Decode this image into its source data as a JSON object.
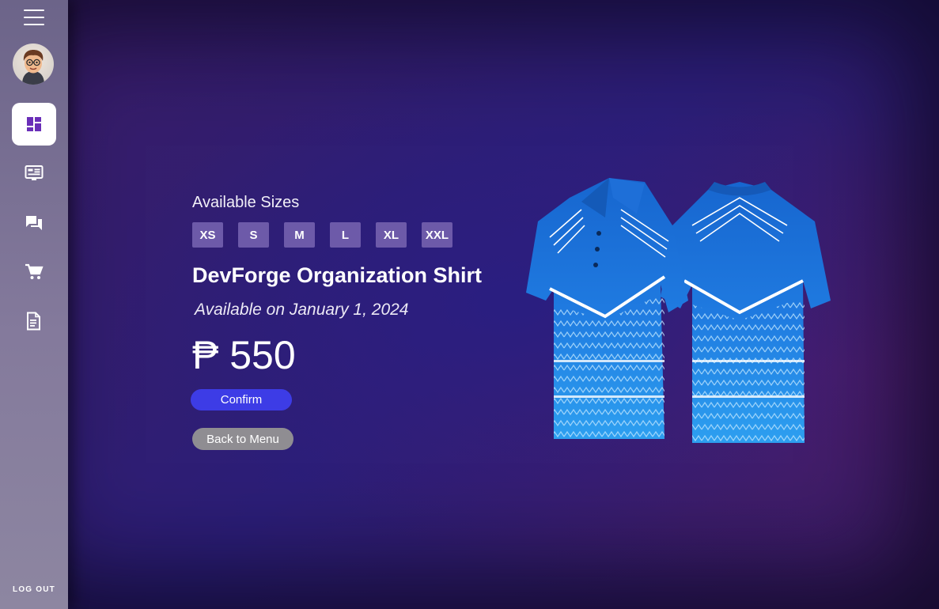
{
  "sidebar": {
    "menu_icon": "hamburger-menu-icon",
    "avatar": "user-avatar",
    "items": [
      {
        "icon": "dashboard-icon",
        "active": true
      },
      {
        "icon": "news-feed-icon",
        "active": false
      },
      {
        "icon": "chat-icon",
        "active": false
      },
      {
        "icon": "shopping-cart-icon",
        "active": false
      },
      {
        "icon": "document-icon",
        "active": false
      }
    ],
    "logout_label": "LOG OUT"
  },
  "product": {
    "sizes_title": "Available Sizes",
    "sizes": [
      "XS",
      "S",
      "M",
      "L",
      "XL",
      "XXL"
    ],
    "name": "DevForge Organization Shirt",
    "availability": "Available on January 1, 2024",
    "price": "₱ 550",
    "image": "blue-polo-shirt-front-and-back"
  },
  "actions": {
    "confirm_label": "Confirm",
    "back_label": "Back to Menu"
  },
  "colors": {
    "accent": "#3d3ce6",
    "active_icon": "#6a2fb8",
    "size_chip": "#6d5aa9",
    "shirt_blue": "#1f73d6"
  }
}
